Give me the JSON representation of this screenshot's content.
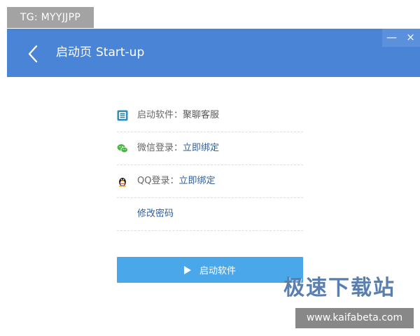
{
  "overlay": {
    "tg_label": "TG: MYYJJPP",
    "site_brand": "极速下载站",
    "site_url": "www.kaifabeta.com"
  },
  "header": {
    "title_cn": "启动页",
    "title_en": "Start-up",
    "minimize_glyph": "—",
    "close_glyph": "×",
    "background_color": "#4a84d6"
  },
  "rows": [
    {
      "icon": "app-logo-icon",
      "label": "启动软件",
      "separator": "：",
      "value": "聚聊客服"
    },
    {
      "icon": "wechat-icon",
      "label": "微信登录",
      "separator": "：",
      "value": "立即绑定"
    },
    {
      "icon": "qq-penguin-icon",
      "label": "QQ登录",
      "separator": "：",
      "value": "立即绑定"
    },
    {
      "label": "修改密码"
    }
  ],
  "start_button": {
    "label": "启动软件",
    "icon": "play-icon",
    "color": "#4aa7ea"
  }
}
